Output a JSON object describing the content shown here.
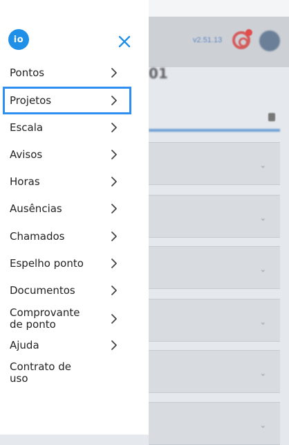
{
  "background": {
    "version": "v2.51.13",
    "page_title": "01"
  },
  "drawer": {
    "logo_text": "io",
    "close_icon": "close-icon",
    "items": [
      {
        "label": "Pontos",
        "has_arrow": true
      },
      {
        "label": "Projetos",
        "has_arrow": true,
        "selected": true
      },
      {
        "label": "Escala",
        "has_arrow": true
      },
      {
        "label": "Avisos",
        "has_arrow": true
      },
      {
        "label": "Horas",
        "has_arrow": true
      },
      {
        "label": "Ausências",
        "has_arrow": true
      },
      {
        "label": "Chamados",
        "has_arrow": true
      },
      {
        "label": "Espelho ponto",
        "has_arrow": true
      },
      {
        "label": "Documentos",
        "has_arrow": true
      },
      {
        "label": "Comprovante\nde ponto",
        "has_arrow": true
      },
      {
        "label": "Ajuda",
        "has_arrow": true
      },
      {
        "label": "Contrato de\nuso",
        "has_arrow": false
      }
    ]
  },
  "colors": {
    "accent": "#1f8fe8",
    "selection_border": "#2e8ff0",
    "overlay": "#e5e8ec"
  }
}
